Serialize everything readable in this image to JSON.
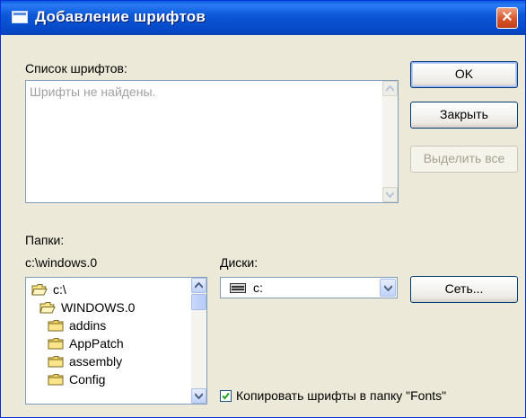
{
  "window": {
    "title": "Добавление шрифтов",
    "close_label": "✕"
  },
  "fonts_list": {
    "label": "Список шрифтов:",
    "label_underline_char": "ш",
    "empty_text": "Шрифты не найдены."
  },
  "buttons": {
    "ok": "OK",
    "close": "Закрыть",
    "select_all": "Выделить все",
    "network": "Сеть..."
  },
  "folders": {
    "label": "Папки:",
    "current_path": "c:\\windows.0",
    "items": [
      {
        "name": "c:\\",
        "icon": "open-folder-icon",
        "indent": 0
      },
      {
        "name": "WINDOWS.0",
        "icon": "open-folder-icon",
        "indent": 1
      },
      {
        "name": "addins",
        "icon": "folder-icon",
        "indent": 2
      },
      {
        "name": "AppPatch",
        "icon": "folder-icon",
        "indent": 2
      },
      {
        "name": "assembly",
        "icon": "folder-icon",
        "indent": 2
      },
      {
        "name": "Config",
        "icon": "folder-icon",
        "indent": 2
      }
    ]
  },
  "drives": {
    "label": "Диски:",
    "selected": "c:",
    "icon": "hard-drive-icon"
  },
  "copy_option": {
    "label": "Копировать шрифты в папку \"Fonts\"",
    "checked": true
  },
  "colors": {
    "title_bar": "#0a5fe0",
    "dialog_bg": "#ece9d8",
    "close_button": "#d8542a"
  }
}
